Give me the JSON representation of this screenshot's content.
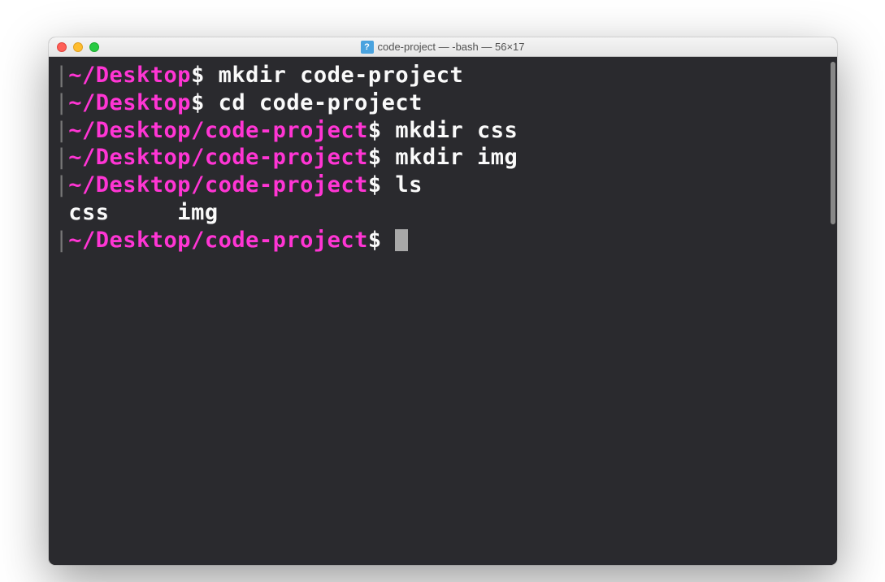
{
  "titlebar": {
    "icon_label": "?",
    "title": "code-project — -bash — 56×17"
  },
  "lines": [
    {
      "prompt": "~/Desktop",
      "dollar": "$",
      "command": "mkdir code-project"
    },
    {
      "prompt": "~/Desktop",
      "dollar": "$",
      "command": "cd code-project"
    },
    {
      "prompt": "~/Desktop/code-project",
      "dollar": "$",
      "command": "mkdir css"
    },
    {
      "prompt": "~/Desktop/code-project",
      "dollar": "$",
      "command": "mkdir img"
    },
    {
      "prompt": "~/Desktop/code-project",
      "dollar": "$",
      "command": "ls"
    }
  ],
  "output": "css     img",
  "current_prompt": {
    "prompt": "~/Desktop/code-project",
    "dollar": "$"
  }
}
